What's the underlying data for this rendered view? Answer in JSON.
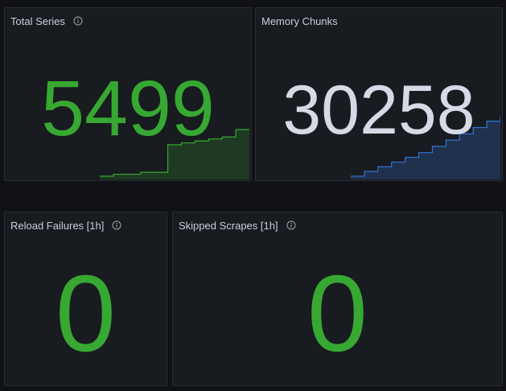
{
  "panels": {
    "total_series": {
      "title": "Total Series",
      "value": "5499",
      "color": "#37a832",
      "sparkline": [
        5380,
        5385,
        5385,
        5390,
        5390,
        5460,
        5465,
        5470,
        5475,
        5480,
        5499,
        5499
      ],
      "icon": "info-icon"
    },
    "memory_chunks": {
      "title": "Memory Chunks",
      "value": "30258",
      "color": "#d8d9e6",
      "spark_color": "#3274d9",
      "sparkline": [
        29500,
        29560,
        29620,
        29680,
        29740,
        29800,
        29880,
        29960,
        30040,
        30120,
        30200,
        30258
      ],
      "icon": "info-icon"
    },
    "reload_failures": {
      "title": "Reload Failures [1h]",
      "value": "0",
      "color": "#37a832",
      "icon": "info-icon"
    },
    "skipped_scrapes": {
      "title": "Skipped Scrapes [1h]",
      "value": "0",
      "color": "#37a832",
      "icon": "info-icon"
    }
  }
}
